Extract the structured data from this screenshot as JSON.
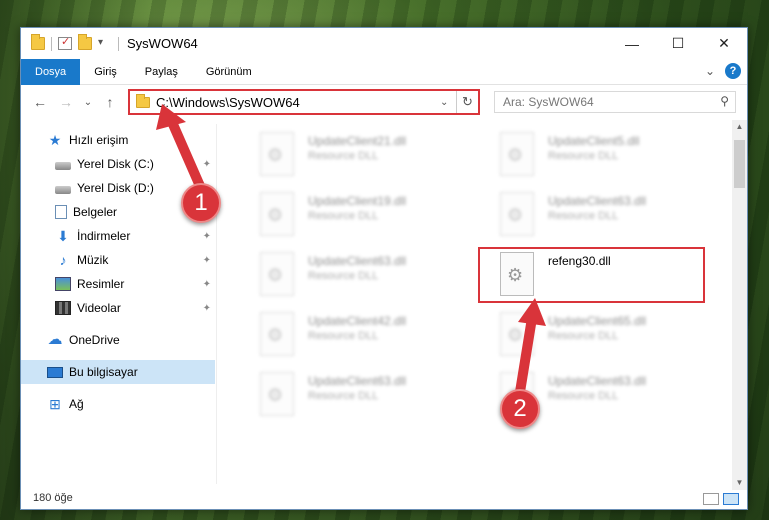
{
  "window": {
    "title": "SysWOW64",
    "minimize": "—",
    "maximize": "☐",
    "close": "✕"
  },
  "ribbon": {
    "tabs": [
      "Dosya",
      "Giriş",
      "Paylaş",
      "Görünüm"
    ],
    "expand": "⌄",
    "help": "?"
  },
  "nav": {
    "back": "←",
    "forward": "→",
    "recent": "⌄",
    "up": "↑"
  },
  "address": {
    "path": "C:\\Windows\\SysWOW64",
    "dropdown": "⌄",
    "refresh": "↻"
  },
  "search": {
    "placeholder": "Ara: SysWOW64",
    "icon": "⚲"
  },
  "sidebar": {
    "items": [
      {
        "label": "Hızlı erişim",
        "icon": "star-icon"
      },
      {
        "label": "Yerel Disk (C:)",
        "icon": "disk-icon",
        "pinned": true
      },
      {
        "label": "Yerel Disk (D:)",
        "icon": "disk-icon"
      },
      {
        "label": "Belgeler",
        "icon": "document-icon"
      },
      {
        "label": "İndirmeler",
        "icon": "download-icon",
        "pinned": true
      },
      {
        "label": "Müzik",
        "icon": "music-icon",
        "pinned": true
      },
      {
        "label": "Resimler",
        "icon": "picture-icon",
        "pinned": true
      },
      {
        "label": "Videolar",
        "icon": "video-icon",
        "pinned": true
      },
      {
        "label": "OneDrive",
        "icon": "cloud-icon"
      },
      {
        "label": "Bu bilgisayar",
        "icon": "computer-icon",
        "selected": true
      },
      {
        "label": "Ağ",
        "icon": "network-icon"
      }
    ],
    "pin_glyph": "📌"
  },
  "files": [
    {
      "name": "UpdateClient21.dll",
      "type": "Resource DLL"
    },
    {
      "name": "UpdateClient5.dll",
      "type": "Resource DLL"
    },
    {
      "name": "UpdateClient19.dll",
      "type": "Resource DLL"
    },
    {
      "name": "UpdateClient63.dll",
      "type": "Resource DLL"
    },
    {
      "name": "UpdateClient63.dll",
      "type": "Resource DLL"
    },
    {
      "name": "refeng30.dll",
      "type": ""
    },
    {
      "name": "UpdateClient42.dll",
      "type": "Resource DLL"
    },
    {
      "name": "UpdateClient65.dll",
      "type": "Resource DLL"
    },
    {
      "name": "UpdateClient63.dll",
      "type": "Resource DLL"
    },
    {
      "name": "UpdateClient63.dll",
      "type": "Resource DLL"
    }
  ],
  "status": {
    "count": "180 öğe"
  },
  "annotations": {
    "badge1": "1",
    "badge2": "2"
  },
  "colors": {
    "accent": "#1979ca",
    "highlight": "#d9343a",
    "selected": "#cce4f7"
  }
}
